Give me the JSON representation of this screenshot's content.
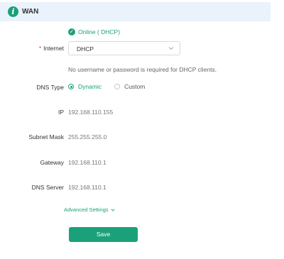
{
  "header": {
    "title": "WAN",
    "icon": "info-icon"
  },
  "status": {
    "text": "Online ( DHCP)",
    "icon": "check-circle-icon"
  },
  "internet": {
    "label": "Internet",
    "required_mark": "*",
    "value": "DHCP"
  },
  "hint": "No username or password is required for DHCP clients.",
  "dns_type": {
    "label": "DNS Type",
    "options": [
      "Dynamic",
      "Custom"
    ],
    "selected": "Dynamic"
  },
  "ip": {
    "label": "IP",
    "value": "192.168.110.155"
  },
  "subnet": {
    "label": "Subnet Mask",
    "value": "255.255.255.0"
  },
  "gateway": {
    "label": "Gateway",
    "value": "192.168.110.1"
  },
  "dns_server": {
    "label": "DNS Server",
    "value": "192.168.110.1"
  },
  "advanced": {
    "label": "Advanced Settings"
  },
  "save_label": "Save",
  "colors": {
    "accent": "#1aa17a",
    "header_bg": "#eaf3fb",
    "required": "#e0393e"
  }
}
